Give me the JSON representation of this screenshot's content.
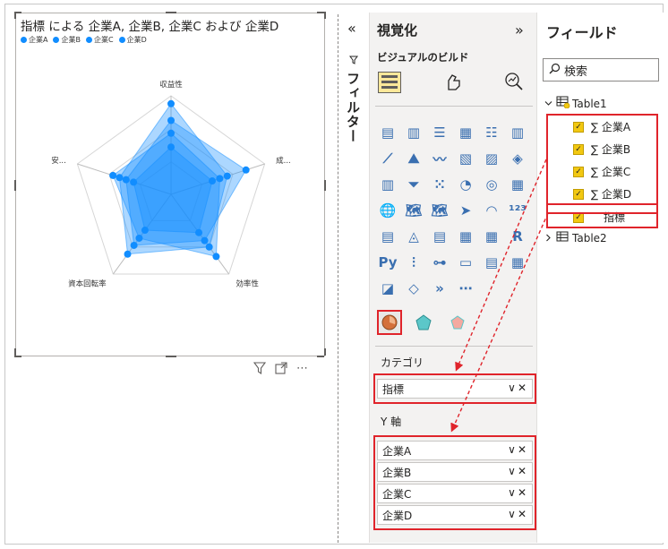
{
  "visual": {
    "title": "指標 による 企業A, 企業B, 企業C および 企業D",
    "legend": [
      "企業A",
      "企業B",
      "企業C",
      "企業D"
    ],
    "toolbar": {
      "filter_icon": "filter-icon",
      "focus_icon": "focus-mode-icon",
      "more": "⋯"
    }
  },
  "chart_data": {
    "type": "radar",
    "categories": [
      "収益性",
      "成...",
      "効率性",
      "資本回転率",
      "安..."
    ],
    "series": [
      {
        "name": "企業A",
        "values": [
          0.92,
          0.6,
          0.66,
          0.75,
          0.55
        ]
      },
      {
        "name": "企業B",
        "values": [
          0.75,
          0.8,
          0.58,
          0.64,
          0.48
        ]
      },
      {
        "name": "企業C",
        "values": [
          0.62,
          0.52,
          0.78,
          0.55,
          0.62
        ]
      },
      {
        "name": "企業D",
        "values": [
          0.48,
          0.44,
          0.48,
          0.45,
          0.4
        ]
      }
    ],
    "rlim": [
      0,
      1
    ],
    "color": "#118dff"
  },
  "filter_pane": {
    "collapse": "«",
    "label": "フィルター"
  },
  "viz_pane": {
    "title": "視覚化",
    "collapse": "»",
    "build_label": "ビジュアルのビルド",
    "category_label": "カテゴリ",
    "category_fields": [
      "指標"
    ],
    "y_label": "Y 軸",
    "y_fields": [
      "企業A",
      "企業B",
      "企業C",
      "企業D"
    ],
    "grid_glyphs": [
      "▤",
      "▥",
      "☰",
      "▦",
      "☷",
      "▥",
      "⟋",
      "⛰",
      "〰",
      "▧",
      "▨",
      "◈",
      "▥",
      "⏷",
      "⁙",
      "◔",
      "◎",
      "▦",
      "🌐",
      "🗺",
      "🗺",
      "➤",
      "◠",
      "¹²³",
      "▤",
      "◬",
      "▤",
      "▦",
      "▦",
      "R",
      "Py",
      "⫶",
      "⊶",
      "▭",
      "▤",
      "▦",
      "◪",
      "◇",
      "»",
      "⋯"
    ],
    "custom_glyphs": [
      "◕",
      "◆",
      "◆"
    ]
  },
  "fields_pane": {
    "title": "フィールド",
    "search_placeholder": "検索",
    "table1": "Table1",
    "table1_fields": [
      "∑ 企業A",
      "∑ 企業B",
      "∑ 企業C",
      "∑ 企業D",
      "指標"
    ],
    "table2": "Table2",
    "check": "✓"
  }
}
